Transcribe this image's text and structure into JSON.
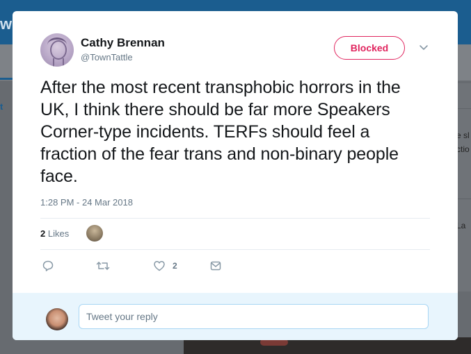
{
  "background": {
    "topbar_letter": "w",
    "nav_letter": "t",
    "right_snippets": [
      "e sl",
      "ctio",
      "La"
    ]
  },
  "tweet": {
    "author_name": "Cathy Brennan",
    "author_handle": "@TownTattle",
    "follow_state_label": "Blocked",
    "text": "After the most recent transphobic horrors in the UK, I think there should be far more Speakers Corner-type incidents. TERFs should feel a fraction of the fear trans and non-binary people face.",
    "timestamp": "1:28 PM - 24 Mar 2018",
    "likes_count": "2",
    "likes_label": "Likes",
    "actions": {
      "like_count": "2"
    }
  },
  "reply": {
    "placeholder": "Tweet your reply"
  },
  "colors": {
    "blocked": "#e0245e",
    "text": "#14171a",
    "muted": "#657786",
    "reply_bg": "#e8f5fd"
  }
}
